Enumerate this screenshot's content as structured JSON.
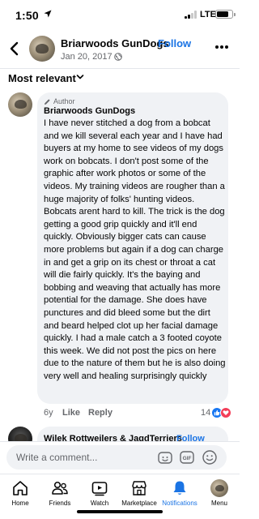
{
  "status_bar": {
    "time": "1:50",
    "network": "LTE",
    "signal_bars": 2,
    "battery_level": 0.85
  },
  "post": {
    "page_name": "Briarwoods GunDogs",
    "separator": "·",
    "follow_label": "Follow",
    "date": "Jan 20, 2017 ·",
    "privacy_icon": "globe-icon"
  },
  "sort": {
    "label": "Most relevant"
  },
  "comment": {
    "badge": "Author",
    "author": "Briarwoods GunDogs",
    "text": "I have never stitched a dog from a bobcat and we kill several each year and I have had buyers at my home to see videos of my dogs work on bobcats. I don't post some of the graphic after work photos or some of the videos. My training videos are rougher than a huge majority of folks' hunting videos.  Bobcats arent hard to kill. The trick is the dog getting a good grip quickly and it'll end quickly. Obviously bigger cats can cause more problems but again if a dog can charge in and get a grip on its chest or throat a cat will die fairly quickly.  It's the baying and bobbing and weaving that actually has more potential for the damage.  She does have punctures and did bleed some but the dirt and beard helped clot up her facial damage quickly.  I had a male catch a 3 footed coyote this week.  We did not post the pics on here due to the nature of them but he is also doing very well and healing surprisingly quickly",
    "age": "6y",
    "like_label": "Like",
    "reply_label": "Reply",
    "reaction_count": "14",
    "reactions": [
      "like-reaction-icon",
      "love-reaction-icon"
    ]
  },
  "next_comment": {
    "author": "Wilek Rottweilers & JagdTerriers",
    "separator": "·",
    "follow_label": "Follow"
  },
  "composer": {
    "placeholder": "Write a comment..."
  },
  "nav": {
    "items": [
      {
        "label": "Home",
        "icon": "home-icon"
      },
      {
        "label": "Friends",
        "icon": "friends-icon"
      },
      {
        "label": "Watch",
        "icon": "watch-icon"
      },
      {
        "label": "Marketplace",
        "icon": "marketplace-icon"
      },
      {
        "label": "Notifications",
        "icon": "bell-icon"
      },
      {
        "label": "Menu",
        "icon": "avatar"
      }
    ],
    "active": "Notifications"
  },
  "colors": {
    "accent": "#1b74e4",
    "bubble": "#f0f2f5",
    "secondary_text": "#65676b",
    "love": "#f33e58"
  }
}
